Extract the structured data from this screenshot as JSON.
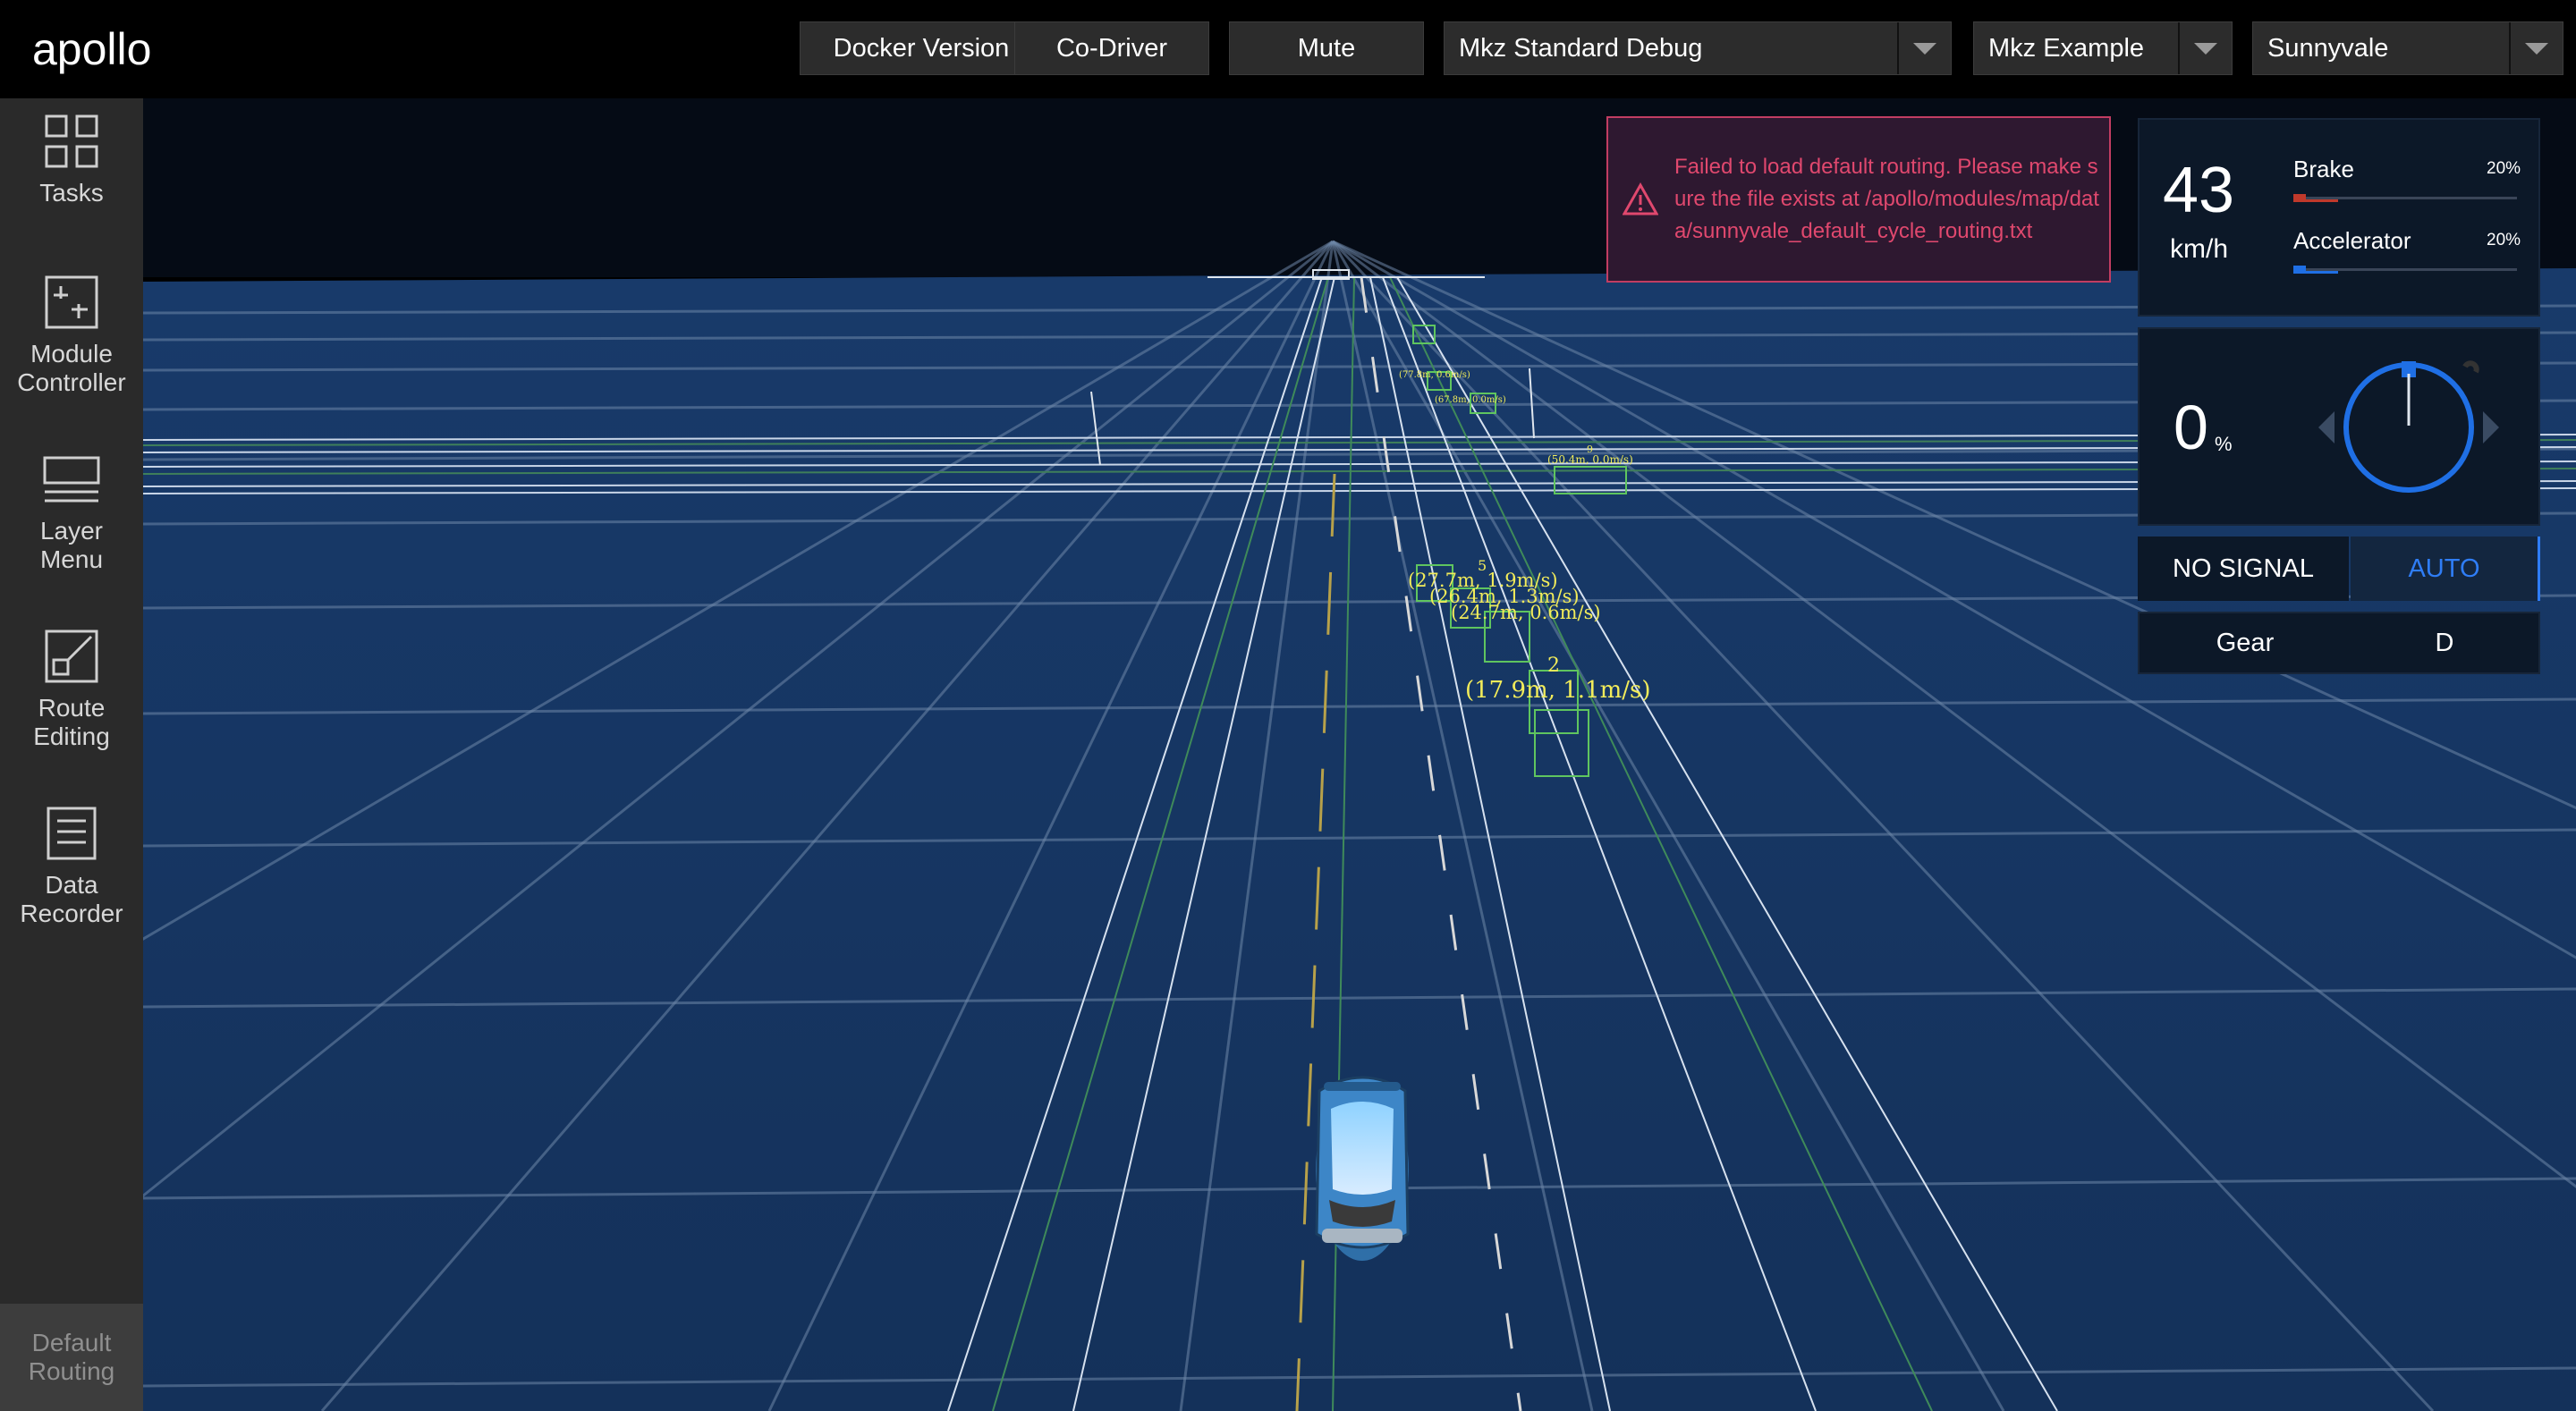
{
  "header": {
    "logo_text": "apollo",
    "docker_version": "Docker Version",
    "co_driver": "Co-Driver",
    "mute": "Mute",
    "mode_select": "Mkz Standard Debug",
    "vehicle_select": "Mkz Example",
    "map_select": "Sunnyvale"
  },
  "sidebar": {
    "items": [
      {
        "label": "Tasks",
        "icon": "tasks-icon"
      },
      {
        "label": "Module Controller",
        "icon": "module-controller-icon"
      },
      {
        "label": "Layer Menu",
        "icon": "layer-menu-icon"
      },
      {
        "label": "Route Editing",
        "icon": "route-editing-icon"
      },
      {
        "label": "Data Recorder",
        "icon": "data-recorder-icon"
      }
    ],
    "default_routing": "Default Routing"
  },
  "alert": {
    "message": "Failed to load default routing. Please make sure the file exists at /apollo/modules/map/data/sunnyvale_default_cycle_routing.txt",
    "color": "#e0486e"
  },
  "dashboard": {
    "speed": "43",
    "speed_unit": "km/h",
    "brake_label": "Brake",
    "brake_pct": "20%",
    "brake_value": 0.2,
    "accelerator_label": "Accelerator",
    "accelerator_pct": "20%",
    "accelerator_value": 0.2,
    "steering_value": "0",
    "steering_unit": "%",
    "signal": "NO SIGNAL",
    "driving_mode": "AUTO",
    "gear_label": "Gear",
    "gear_value": "D",
    "brake_color": "#c0392b",
    "accelerator_color": "#1f6fe5",
    "auto_color": "#2f7df6"
  },
  "obstacles": [
    {
      "id": "2",
      "label": "(17.9m, 1.1m/s)"
    },
    {
      "id": "5",
      "label": "(27.7m, 1.9m/s)"
    },
    {
      "id": "",
      "label": "(26.4m, 1.3m/s)"
    },
    {
      "id": "",
      "label": "(24.7m, 0.6m/s)"
    },
    {
      "id": "9",
      "label": "(50.4m, 0.0m/s)"
    },
    {
      "id": "",
      "label": "(77.8m, 0.6m/s)"
    },
    {
      "id": "",
      "label": "(67.8m, 0.0m/s)"
    }
  ]
}
